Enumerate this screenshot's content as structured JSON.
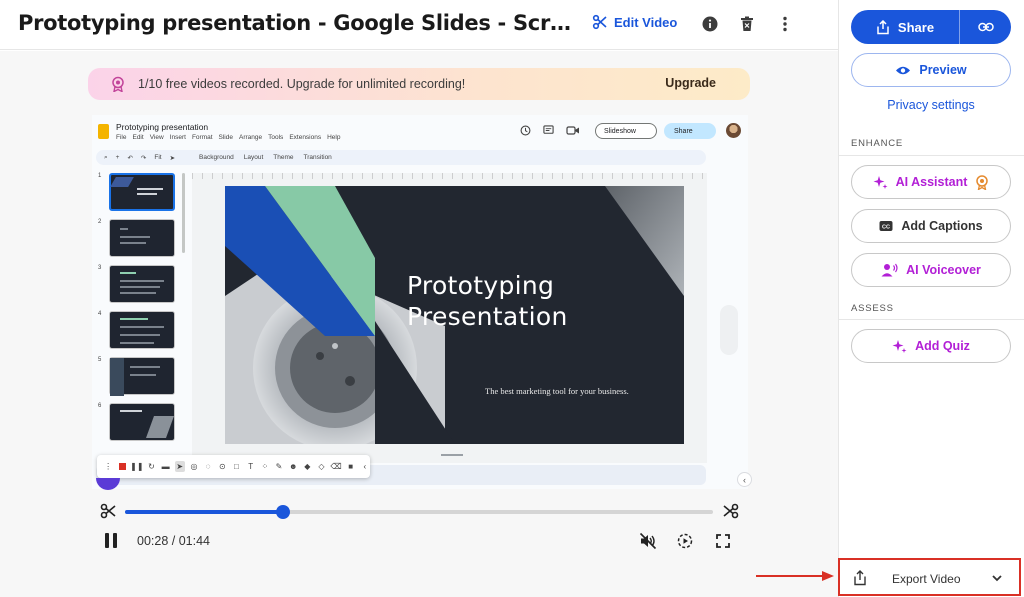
{
  "header": {
    "title": "Prototyping presentation - Google Slides - Screencastify - A...",
    "edit_video_label": "Edit Video"
  },
  "banner": {
    "text": "1/10 free videos recorded. Upgrade for unlimited recording!",
    "upgrade_label": "Upgrade"
  },
  "recording": {
    "slides_app": {
      "doc_title": "Prototyping presentation",
      "menu": [
        "File",
        "Edit",
        "View",
        "Insert",
        "Format",
        "Slide",
        "Arrange",
        "Tools",
        "Extensions",
        "Help"
      ],
      "slideshow_label": "Slideshow",
      "share_label": "Share",
      "toolbar_zoom": "Fit",
      "toolbar_items": [
        "Background",
        "Layout",
        "Theme",
        "Transition"
      ],
      "thumbnail_numbers": [
        "1",
        "2",
        "3",
        "4",
        "5",
        "6"
      ]
    },
    "slide": {
      "title": "Prototyping Presentation",
      "subtitle": "The best marketing tool for your business."
    }
  },
  "player": {
    "current_time": "00:28",
    "duration": "01:44",
    "time_display": "00:28 / 01:44",
    "progress": 0.269
  },
  "panel": {
    "share_label": "Share",
    "preview_label": "Preview",
    "privacy_label": "Privacy settings",
    "enhance_label": "ENHANCE",
    "ai_assistant_label": "AI Assistant",
    "add_captions_label": "Add Captions",
    "ai_voiceover_label": "AI Voiceover",
    "assess_label": "ASSESS",
    "add_quiz_label": "Add Quiz",
    "export_label": "Export Video"
  },
  "colors": {
    "accent": "#1a56db",
    "ai_purple": "#b21fd6",
    "highlight_red": "#d93025"
  }
}
